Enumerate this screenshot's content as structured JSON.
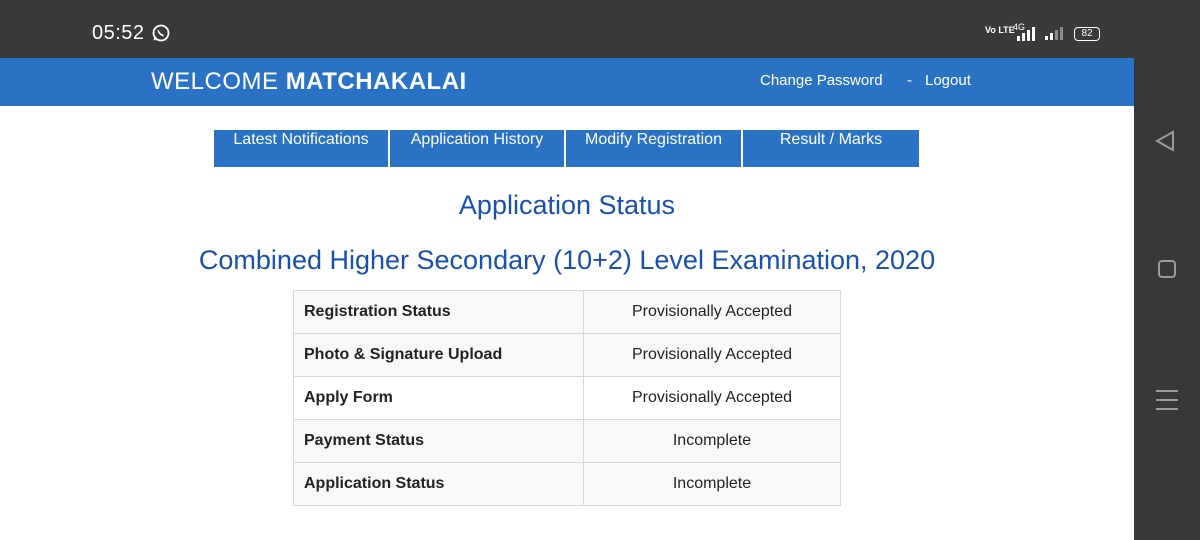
{
  "status_bar": {
    "time": "05:52",
    "app_icon": "whatsapp-icon",
    "volte": "Vo LTE",
    "network": "4G",
    "battery": "82"
  },
  "header": {
    "welcome_prefix": "WELCOME",
    "username": "MATCHAKALAI",
    "change_password": "Change Password",
    "separator": "-",
    "logout": "Logout"
  },
  "tabs": [
    {
      "label": "Latest Notifications"
    },
    {
      "label": "Application History"
    },
    {
      "label": "Modify Registration"
    },
    {
      "label": "Result / Marks"
    }
  ],
  "page": {
    "title": "Application Status",
    "subtitle": "Combined Higher Secondary (10+2) Level Examination, 2020"
  },
  "status_table": {
    "rows": [
      {
        "label": "Registration Status",
        "value": "Provisionally Accepted"
      },
      {
        "label": "Photo & Signature Upload",
        "value": "Provisionally Accepted"
      },
      {
        "label": "Apply Form",
        "value": "Provisionally Accepted"
      },
      {
        "label": "Payment Status",
        "value": "Incomplete"
      },
      {
        "label": "Application Status",
        "value": "Incomplete"
      }
    ]
  },
  "colors": {
    "brand_blue": "#2a73c4",
    "heading_blue": "#1a50b0",
    "status_bar": "#3a3a3a",
    "nav_bar": "#383838"
  },
  "nav_icons": [
    "back-icon",
    "home-icon",
    "recents-icon"
  ]
}
